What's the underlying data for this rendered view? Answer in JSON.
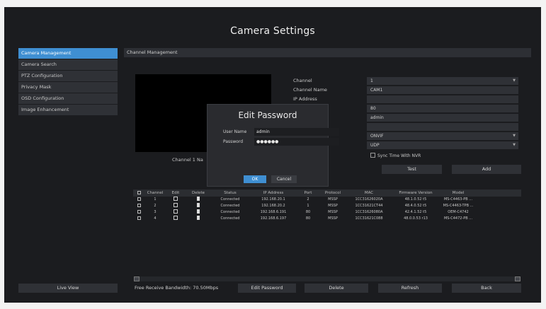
{
  "window": {
    "title": "Camera Settings"
  },
  "sidebar": {
    "items": [
      {
        "label": "Camera Management",
        "active": true
      },
      {
        "label": "Camera Search",
        "active": false
      },
      {
        "label": "PTZ Configuration",
        "active": false
      },
      {
        "label": "Privacy Mask",
        "active": false
      },
      {
        "label": "OSD Configuration",
        "active": false
      },
      {
        "label": "Image Enhancement",
        "active": false
      }
    ],
    "live_view_label": "Live View"
  },
  "section": {
    "title": "Channel Management"
  },
  "preview": {
    "label": "Channel 1 Na"
  },
  "form": {
    "rows": [
      {
        "label": "Channel",
        "value": "1",
        "dropdown": true
      },
      {
        "label": "Channel Name",
        "value": "CAM1",
        "dropdown": false
      },
      {
        "label": "IP Address",
        "value": "",
        "dropdown": false
      },
      {
        "label": "",
        "value": "80",
        "dropdown": false
      },
      {
        "label": "",
        "value": "admin",
        "dropdown": false
      },
      {
        "label": "",
        "value": "",
        "dropdown": false
      },
      {
        "label": "",
        "value": "ONVIF",
        "dropdown": true
      },
      {
        "label": "",
        "value": "UDP",
        "dropdown": true
      }
    ],
    "sync_time_label": "Sync Time With NVR",
    "test_label": "Test",
    "add_label": "Add"
  },
  "table": {
    "headers": [
      "",
      "Channel",
      "Edit",
      "Delete",
      "Status",
      "IP Address",
      "Port",
      "Protocol",
      "MAC",
      "Firmware Version",
      "Model",
      ""
    ],
    "rows": [
      [
        "",
        "1",
        "",
        "",
        "Connected",
        "192.168.20.1",
        "2",
        "MSSP",
        "1CC31626020A",
        "48.1.0.52 t5",
        "MS-C4463-PB ..."
      ],
      [
        "",
        "2",
        "",
        "",
        "Connected",
        "192.168.20.2",
        "1",
        "MSSP",
        "1CC31621CT44",
        "48.4.0.52 t5",
        "MS-C4463-TPB ..."
      ],
      [
        "",
        "3",
        "",
        "",
        "Connected",
        "192.168.6.191",
        "80",
        "MSSP",
        "1CC31626080A",
        "42.4.1.52 t5",
        "OEM-C4742"
      ],
      [
        "",
        "4",
        "",
        "",
        "Connected",
        "192.168.6.197",
        "80",
        "MSSP",
        "1CC31621C088",
        "48.0.0.53 r13",
        "MS-C4472-PB ..."
      ]
    ]
  },
  "footer": {
    "bandwidth": "Free Receive Bandwidth: 70.50Mbps",
    "edit_password_label": "Edit Password",
    "delete_label": "Delete",
    "refresh_label": "Refresh",
    "back_label": "Back"
  },
  "modal": {
    "title": "Edit Password",
    "username_label": "User Name",
    "username_value": "admin",
    "password_label": "Password",
    "password_value": "●●●●●●",
    "ok_label": "OK",
    "cancel_label": "Cancel"
  },
  "colors": {
    "accent": "#3f8fd2",
    "background": "#1b1c1f",
    "panel": "#2f3136"
  }
}
